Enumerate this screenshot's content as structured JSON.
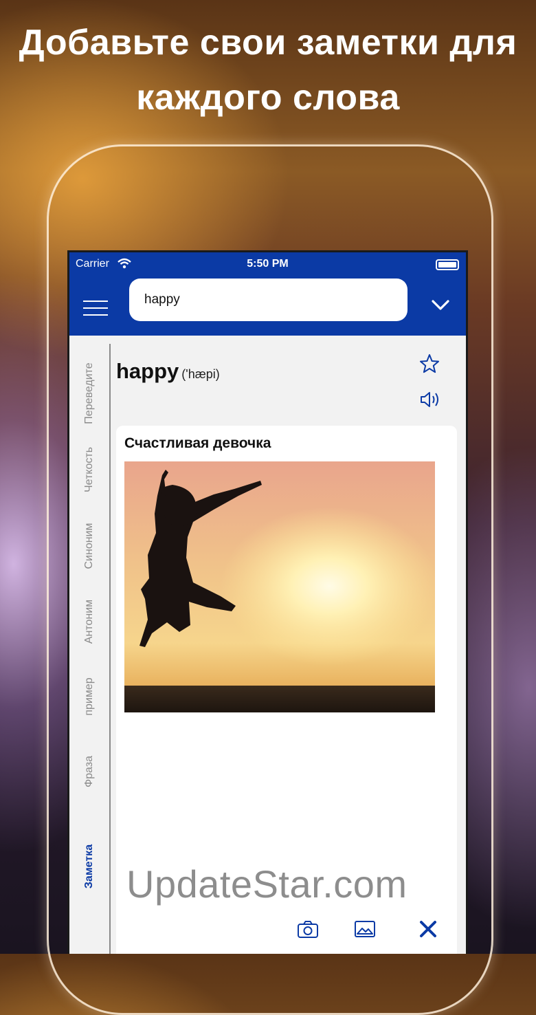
{
  "headline": {
    "line1": "Добавьте свои заметки для",
    "line2": "каждого слова"
  },
  "status_bar": {
    "carrier": "Carrier",
    "time": "5:50 PM"
  },
  "search": {
    "value": "happy"
  },
  "entry": {
    "word": "happy",
    "phonetic": "('hæpi)"
  },
  "side_tabs": [
    "Переведите",
    "Четкость",
    "Синоним",
    "Антоним",
    "пример",
    "Фраза",
    "Заметка"
  ],
  "active_tab": "Заметка",
  "note": {
    "title": "Счастливая девочка"
  },
  "watermark": "UpdateStar.com",
  "colors": {
    "brand": "#0b3aa5",
    "tab_inactive": "#8a8a8a"
  },
  "icons": [
    "menu-icon",
    "wifi-icon",
    "battery-icon",
    "chevron-down-icon",
    "star-icon",
    "speaker-icon",
    "camera-icon",
    "image-icon",
    "close-icon"
  ]
}
